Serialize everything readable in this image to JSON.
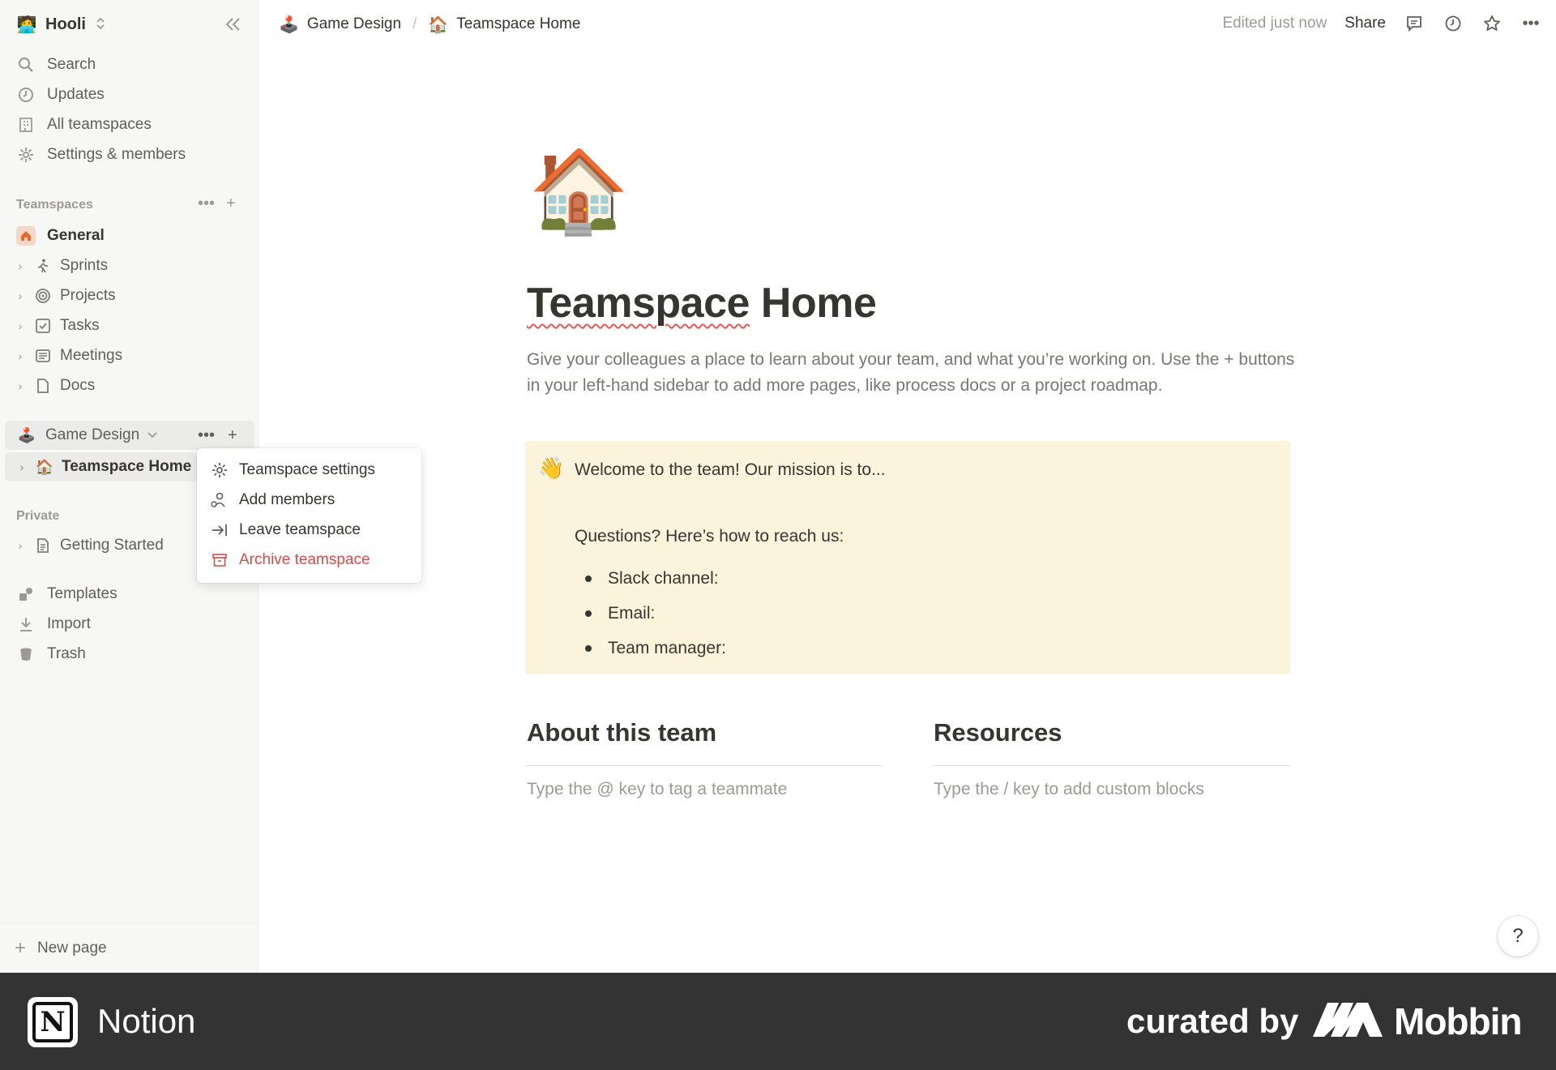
{
  "workspace": {
    "name": "Hooli",
    "avatar": "🧑‍💻"
  },
  "sidebar": {
    "nav": [
      {
        "label": "Search",
        "icon": "search-icon"
      },
      {
        "label": "Updates",
        "icon": "clock-icon"
      },
      {
        "label": "All teamspaces",
        "icon": "building-icon"
      },
      {
        "label": "Settings & members",
        "icon": "gear-icon"
      }
    ],
    "teamspaces_label": "Teamspaces",
    "general_label": "General",
    "general_items": [
      {
        "label": "Sprints",
        "icon": "runner-icon"
      },
      {
        "label": "Projects",
        "icon": "target-icon"
      },
      {
        "label": "Tasks",
        "icon": "checkbox-icon"
      },
      {
        "label": "Meetings",
        "icon": "notes-icon"
      },
      {
        "label": "Docs",
        "icon": "page-icon"
      }
    ],
    "game_design_label": "Game Design",
    "game_design_emoji": "🕹️",
    "teamspace_home_label": "Teamspace Home",
    "teamspace_home_emoji": "🏠",
    "private_label": "Private",
    "private_items": [
      {
        "label": "Getting Started",
        "icon": "document-icon"
      }
    ],
    "bottom": [
      {
        "label": "Templates",
        "icon": "templates-icon"
      },
      {
        "label": "Import",
        "icon": "download-icon"
      },
      {
        "label": "Trash",
        "icon": "trash-icon"
      }
    ],
    "new_page_label": "New page"
  },
  "context_menu": {
    "items": [
      {
        "label": "Teamspace settings",
        "icon": "gear-icon"
      },
      {
        "label": "Add members",
        "icon": "add-user-icon"
      },
      {
        "label": "Leave teamspace",
        "icon": "leave-icon"
      },
      {
        "label": "Archive teamspace",
        "icon": "archive-icon",
        "danger": true
      }
    ]
  },
  "topbar": {
    "breadcrumb": [
      {
        "label": "Game Design",
        "emoji": "🕹️"
      },
      {
        "label": "Teamspace Home",
        "emoji": "🏠"
      }
    ],
    "edited_text": "Edited just now",
    "share_label": "Share"
  },
  "page": {
    "emoji": "🏠",
    "title_first": "Teamspace",
    "title_rest": " Home",
    "description": "Give your colleagues a place to learn about your team, and what you’re working on. Use the + buttons in your left-hand sidebar to add more pages, like process docs or a project roadmap.",
    "callout": {
      "emoji": "👋",
      "title": "Welcome to the team! Our mission is to...",
      "question": "Questions? Here’s how to reach us:",
      "items": [
        "Slack channel:",
        "Email:",
        "Team manager:"
      ]
    },
    "columns": [
      {
        "heading": "About this team",
        "placeholder": "Type the @ key to tag a teammate"
      },
      {
        "heading": "Resources",
        "placeholder": "Type the / key to add custom blocks"
      }
    ],
    "help_label": "?"
  },
  "footer": {
    "app_name": "Notion",
    "logo_letter": "N",
    "curated_by": "curated by",
    "brand": "Mobbin"
  },
  "colors": {
    "sidebar_bg": "#f7f7f5",
    "callout_bg": "#fbf3db",
    "danger": "#d44c47",
    "footer_bg": "#333333"
  }
}
